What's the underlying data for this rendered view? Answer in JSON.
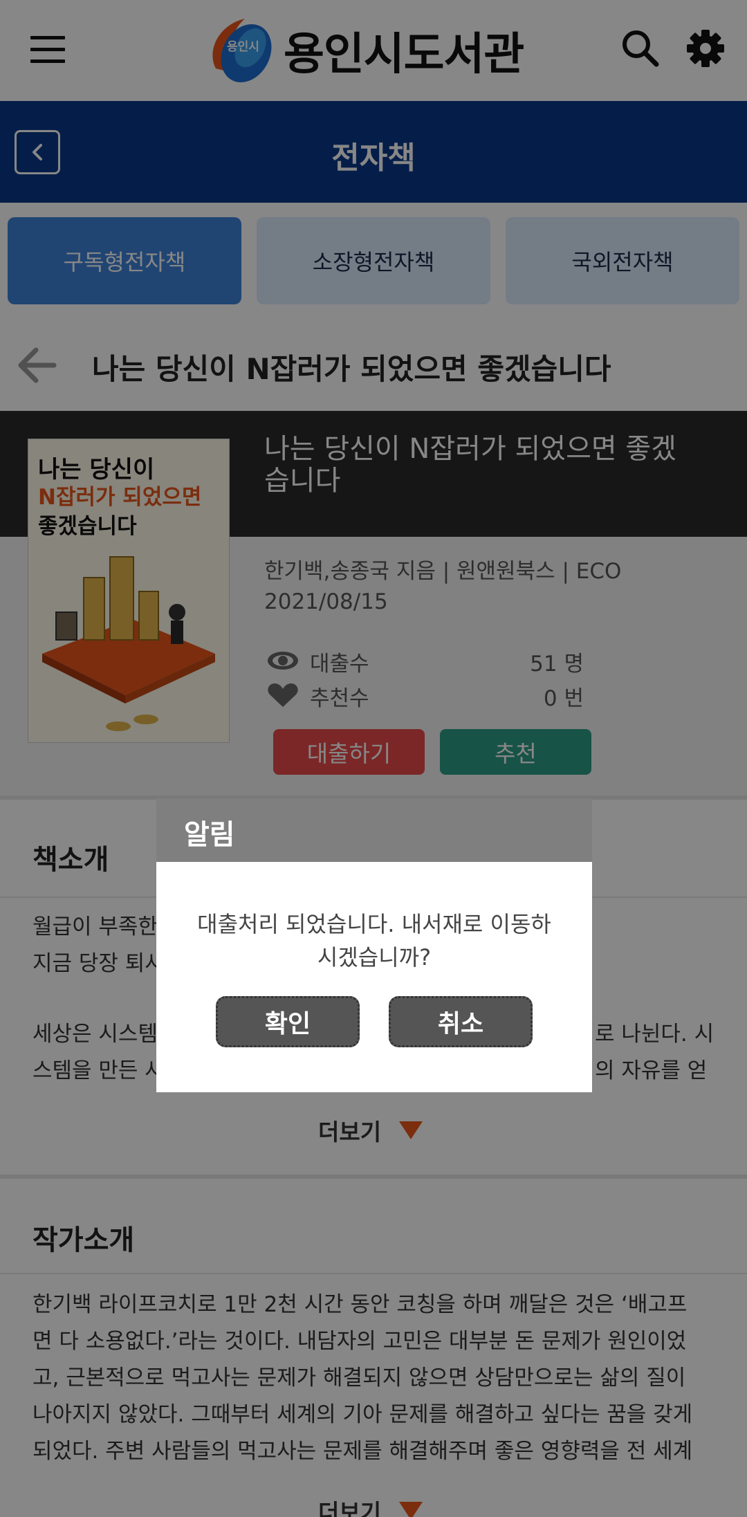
{
  "header": {
    "logo_badge": "용인시",
    "logo_title": "용인시도서관",
    "menu_icon": "hamburger-menu-icon",
    "search_icon": "search-icon",
    "settings_icon": "gear-icon"
  },
  "subheader": {
    "title": "전자책",
    "back_icon": "chevron-left-icon"
  },
  "tabs": [
    {
      "label": "구독형전자책",
      "active": true
    },
    {
      "label": "소장형전자책",
      "active": false
    },
    {
      "label": "국외전자책",
      "active": false
    }
  ],
  "page_title": "나는 당신이 N잡러가 되었으면 좋겠습니다",
  "book": {
    "cover_line1": "나는 당신이",
    "cover_line2": "N잡러가 되었으면",
    "cover_line3": "좋겠습니다",
    "title_line1": "나는 당신이 N잡러가 되었으면 좋겠",
    "title_line2": "습니다",
    "meta_line1": "한기백,송종국 지음 | 원앤원북스 | ECO",
    "meta_line2": "2021/08/15",
    "loans_label": "대출수",
    "loans_value": "51 명",
    "recommend_label": "추천수",
    "recommend_value": "0 번",
    "loan_button": "대출하기",
    "recommend_button": "추천"
  },
  "intro": {
    "title": "책소개",
    "lines": [
      "월급이 부족한",
      "지금 당장 퇴사",
      "세상은 시스템",
      "스템을 만든 사"
    ],
    "lines_right": [
      "로 나뉜다. 시",
      "의 자유를 얻"
    ],
    "more": "더보기"
  },
  "author": {
    "title": "작가소개",
    "lines": [
      "한기백 라이프코치로 1만 2천 시간 동안 코칭을 하며 깨달은 것은 ‘배고프",
      "면 다 소용없다.’라는 것이다. 내담자의 고민은 대부분 돈 문제가 원인이었",
      "고, 근본적으로 먹고사는 문제가 해결되지 않으면 상담만으로는 삶의 질이",
      "나아지지 않았다. 그때부터 세계의 기아 문제를 해결하고 싶다는 꿈을 갖게",
      "되었다. 주변 사람들의 먹고사는 문제를 해결해주며 좋은 영향력을 전 세계"
    ],
    "more": "더보기"
  },
  "dialog": {
    "title": "알림",
    "message_line1": "대출처리 되었습니다. 내서재로 이동하",
    "message_line2": "시겠습니까?",
    "confirm": "확인",
    "cancel": "취소"
  },
  "colors": {
    "brand_blue": "#0b3a8a",
    "tab_active": "#3f82d9",
    "tab_idle": "#dbeafd",
    "loan_button": "#e84a4a",
    "recommend_button": "#2e9e86",
    "accent_orange": "#e8561b"
  }
}
